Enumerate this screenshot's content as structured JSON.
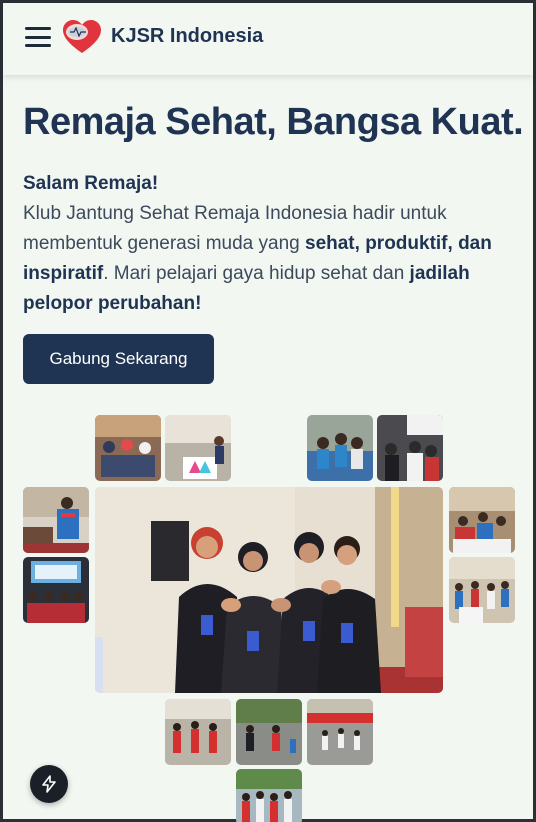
{
  "header": {
    "brand": "KJSR Indonesia",
    "menu_icon": "hamburger-menu-icon",
    "logo_icon": "heart-logo-icon"
  },
  "hero": {
    "title": "Remaja Sehat, Bangsa Kuat.",
    "greeting": "Salam Remaja!",
    "text_1": "Klub Jantung Sehat Remaja Indonesia hadir untuk membentuk generasi muda yang ",
    "text_bold_1": "sehat, produktif, dan inspiratif",
    "text_2": ". Mari pelajari gaya hidup sehat dan ",
    "text_bold_2": "jadilah pelopor perubahan!",
    "cta_label": "Gabung Sekarang"
  },
  "gallery": {
    "photos": [
      "photo-audience-seated",
      "photo-presenter-stage",
      "photo-group-blue-shirts",
      "photo-crowd-event",
      "photo-speaker-podium",
      "photo-classroom-screen",
      "photo-main-group-heart-hands",
      "photo-indoor-workshop",
      "photo-students-activity",
      "photo-outdoor-exercise-1",
      "photo-outdoor-exercise-2",
      "photo-outdoor-exercise-3",
      "photo-outdoor-group"
    ]
  },
  "fab": {
    "icon": "lightning-bolt-icon"
  },
  "colors": {
    "primary": "#1f3352",
    "background": "#f3f7f2",
    "accent_red": "#e0353f"
  }
}
